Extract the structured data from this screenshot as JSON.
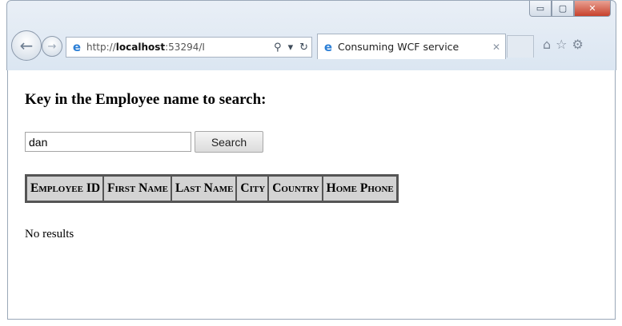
{
  "browser": {
    "address_url_prefix": "http://",
    "address_url_host": "localhost",
    "address_url_rest": ":53294/I",
    "search_glyph": "⚲",
    "dropdown_glyph": "▾",
    "refresh_glyph": "↻",
    "tab_title": "Consuming WCF service",
    "tab_close_glyph": "✕",
    "window_controls": {
      "minimize": "▭",
      "maximize": "▢",
      "close": "✕"
    },
    "nav": {
      "back_glyph": "←",
      "forward_glyph": "→"
    },
    "toolbar_icons": {
      "home": "⌂",
      "favorites": "☆",
      "tools": "⚙"
    }
  },
  "page": {
    "title": "Key in the Employee name to search:",
    "search": {
      "value": "dan",
      "button_label": "Search"
    },
    "table": {
      "headers": [
        "Employee ID",
        "First Name",
        "Last Name",
        "City",
        "Country",
        "Home Phone"
      ]
    },
    "status_text": "No results"
  },
  "colors": {
    "header_bg": "#d3d3d3",
    "close_button": "#c7422c",
    "chrome": "#dbe6f2"
  }
}
